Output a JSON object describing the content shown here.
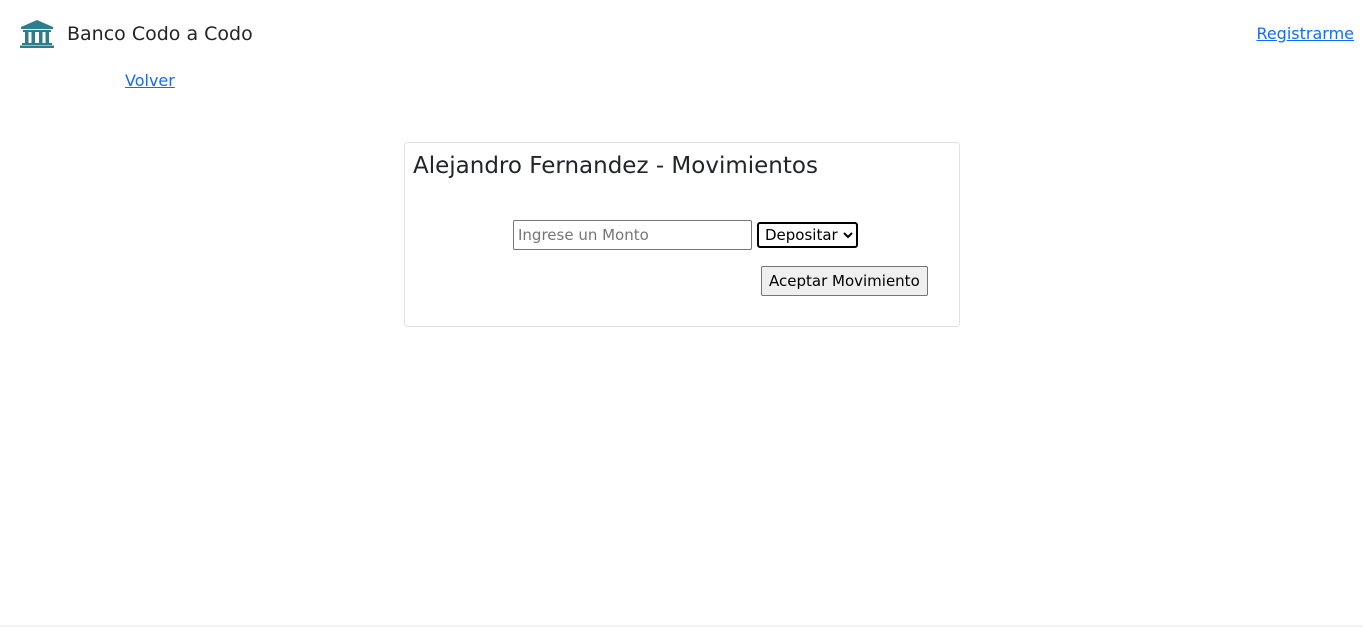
{
  "header": {
    "brand_icon": "bank-icon",
    "brand_name": "Banco Codo a Codo",
    "register_label": "Registrarme"
  },
  "nav": {
    "back_label": "Volver"
  },
  "card": {
    "title": "Alejandro Fernandez - Movimientos",
    "amount_placeholder": "Ingrese un Monto",
    "amount_value": "",
    "type_selected": "Depositar",
    "accept_label": "Aceptar Movimiento"
  },
  "colors": {
    "link": "#0d6efd",
    "icon": "#2e7d8c",
    "text": "#212529"
  }
}
